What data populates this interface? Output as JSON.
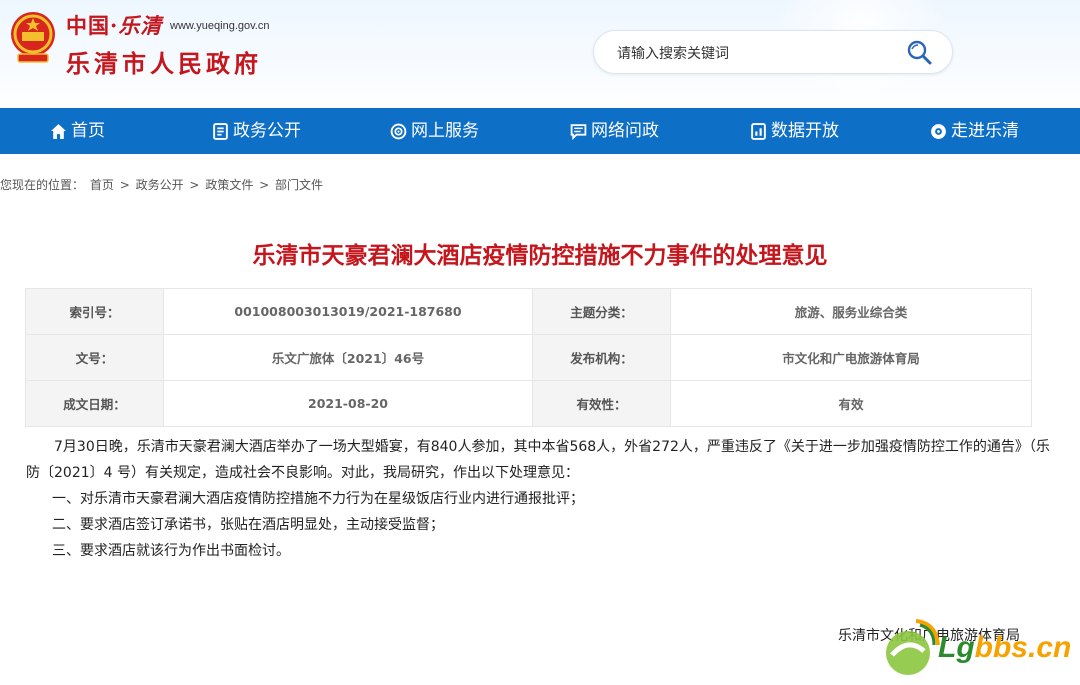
{
  "header": {
    "site_line1_a": "中国",
    "site_line1_dot": "·",
    "site_line1_b": "乐清",
    "url": "www.yueqing.gov.cn",
    "site_name": "乐清市人民政府",
    "search_placeholder": "请输入搜索关键词"
  },
  "nav": [
    {
      "label": "首页",
      "icon": "home-icon"
    },
    {
      "label": "政务公开",
      "icon": "document-icon"
    },
    {
      "label": "网上服务",
      "icon": "service-icon"
    },
    {
      "label": "网络问政",
      "icon": "chat-icon"
    },
    {
      "label": "数据开放",
      "icon": "data-icon"
    },
    {
      "label": "走进乐清",
      "icon": "eye-icon"
    }
  ],
  "breadcrumb": {
    "prefix": "您现在的位置：",
    "items": [
      "首页",
      "政务公开",
      "政策文件",
      "部门文件"
    ],
    "sep": ">"
  },
  "article": {
    "title": "乐清市天豪君澜大酒店疫情防控措施不力事件的处理意见",
    "meta": {
      "index_label": "索引号：",
      "index_value": "001008003013019/2021-187680",
      "topic_label": "主题分类：",
      "topic_value": "旅游、服务业综合类",
      "docno_label": "文号：",
      "docno_value": "乐文广旅体〔2021〕46号",
      "org_label": "发布机构：",
      "org_value": "市文化和广电旅游体育局",
      "date_label": "成文日期：",
      "date_value": "2021-08-20",
      "valid_label": "有效性：",
      "valid_value": "有效"
    },
    "para1": "7月30日晚，乐清市天豪君澜大酒店举办了一场大型婚宴，有840人参加，其中本省568人，外省272人，严重违反了《关于进一步加强疫情防控工作的通告》（乐防〔2021〕4 号）有关规定，造成社会不良影响。对此，我局研究，作出以下处理意见：",
    "item1": "一、对乐清市天豪君澜大酒店疫情防控措施不力行为在星级饭店行业内进行通报批评；",
    "item2": "二、要求酒店签订承诺书，张贴在酒店明显处，主动接受监督；",
    "item3": "三、要求酒店就该行为作出书面检讨。",
    "signature": "乐清市文化和广电旅游体育局"
  },
  "watermark": {
    "text_a": "Lg",
    "text_b": "bbs.cn"
  },
  "colors": {
    "brand_red": "#c4161c",
    "nav_blue": "#0e6fc7"
  }
}
